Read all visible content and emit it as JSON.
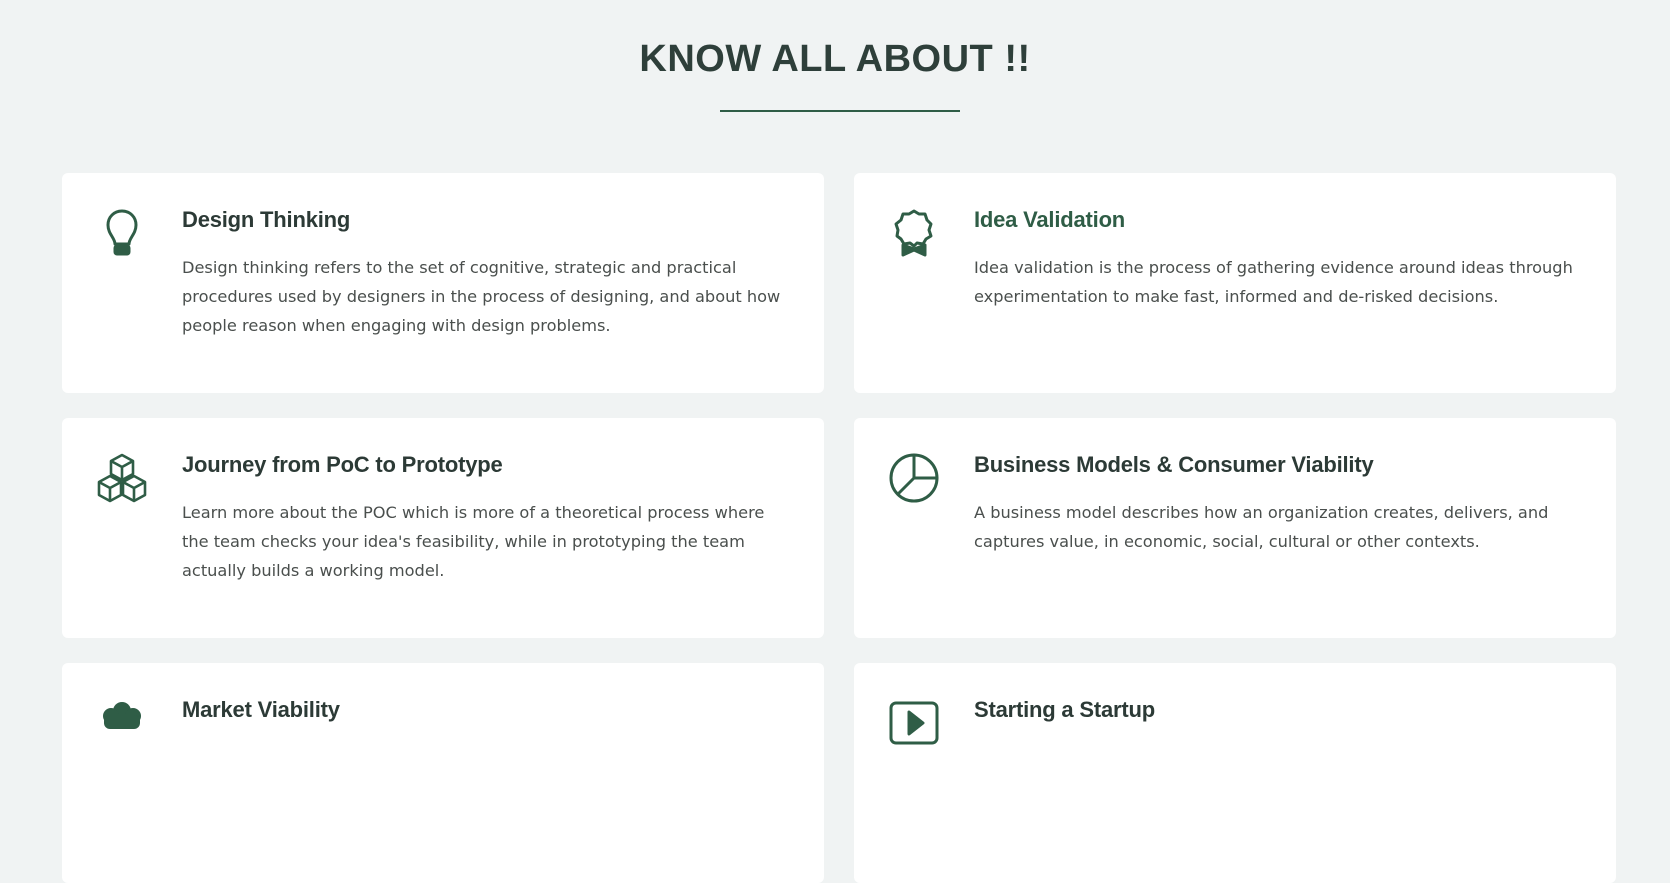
{
  "section": {
    "title": "KNOW ALL ABOUT !!"
  },
  "colors": {
    "accent": "#2f5d46",
    "background": "#f0f3f3",
    "card": "#ffffff",
    "text": "#4a4f4d"
  },
  "cards": [
    {
      "icon": "lightbulb-icon",
      "title": "Design Thinking",
      "description": "Design thinking refers to the set of cognitive, strategic and practical procedures used by designers in the process of designing, and about how people reason when engaging with design problems."
    },
    {
      "icon": "award-badge-icon",
      "title": "Idea Validation",
      "description": "Idea validation is the process of gathering evidence around ideas through experimentation to make fast, informed and de-risked decisions."
    },
    {
      "icon": "cubes-icon",
      "title": "Journey from PoC to Prototype",
      "description": "Learn more about the POC which is more of a theoretical process where the team checks your idea's feasibility, while in prototyping the team actually builds a working model."
    },
    {
      "icon": "pie-chart-icon",
      "title": "Business Models & Consumer Viability",
      "description": "A business model describes how an organization creates, delivers, and captures value, in economic, social, cultural or other contexts."
    },
    {
      "icon": "cloud-icon",
      "title": "Market Viability",
      "description": ""
    },
    {
      "icon": "play-icon",
      "title": "Starting a Startup",
      "description": ""
    }
  ]
}
